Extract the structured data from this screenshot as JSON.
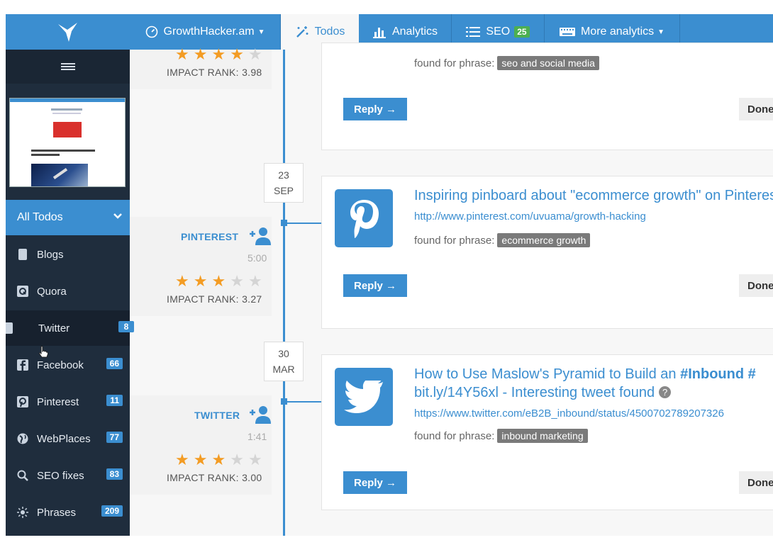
{
  "topbar": {
    "site": "GrowthHacker.am",
    "todos": "Todos",
    "analytics": "Analytics",
    "seo": "SEO",
    "seo_badge": "25",
    "more": "More analytics"
  },
  "sidebar": {
    "all_todos": "All Todos",
    "items": [
      {
        "label": "Blogs",
        "badge": ""
      },
      {
        "label": "Quora",
        "badge": ""
      },
      {
        "label": "Twitter",
        "badge": "8"
      },
      {
        "label": "Facebook",
        "badge": "66"
      },
      {
        "label": "Pinterest",
        "badge": "11"
      },
      {
        "label": "WebPlaces",
        "badge": "77"
      },
      {
        "label": "SEO fixes",
        "badge": "83"
      },
      {
        "label": "Phrases",
        "badge": "209"
      }
    ]
  },
  "feed": {
    "top": {
      "rating": 4,
      "impact": "IMPACT RANK: 3.98",
      "found_label": "found for phrase:",
      "phrase": "seo and social media",
      "reply": "Reply →",
      "done": "Done"
    },
    "items": [
      {
        "date_day": "23",
        "date_month": "SEP",
        "source": "PINTEREST",
        "time": "5:00",
        "rating": 3,
        "impact": "IMPACT RANK: 3.27",
        "title": "Inspiring pinboard about \"ecommerce growth\" on Pinterest",
        "url": "http://www.pinterest.com/uvuama/growth-hacking",
        "found_label": "found for phrase:",
        "phrase": "ecommerce growth",
        "reply": "Reply →",
        "done": "Done"
      },
      {
        "date_day": "30",
        "date_month": "MAR",
        "source": "TWITTER",
        "time": "1:41",
        "rating": 3,
        "impact": "IMPACT RANK: 3.00",
        "title_prefix": "How to Use Maslow's Pyramid to Build an ",
        "title_tag": "#Inbound #",
        "title_line2": "bit.ly/14Y56xl - Interesting tweet found",
        "url": "https://www.twitter.com/eB2B_inbound/status/4500702789207326",
        "found_label": "found for phrase:",
        "phrase": "inbound marketing",
        "reply": "Reply →",
        "done": "Done"
      }
    ]
  },
  "colors": {
    "accent": "#3b8ed0",
    "sidebar": "#1f2d3d",
    "star": "#f39c24",
    "seo_badge": "#4caf50"
  }
}
